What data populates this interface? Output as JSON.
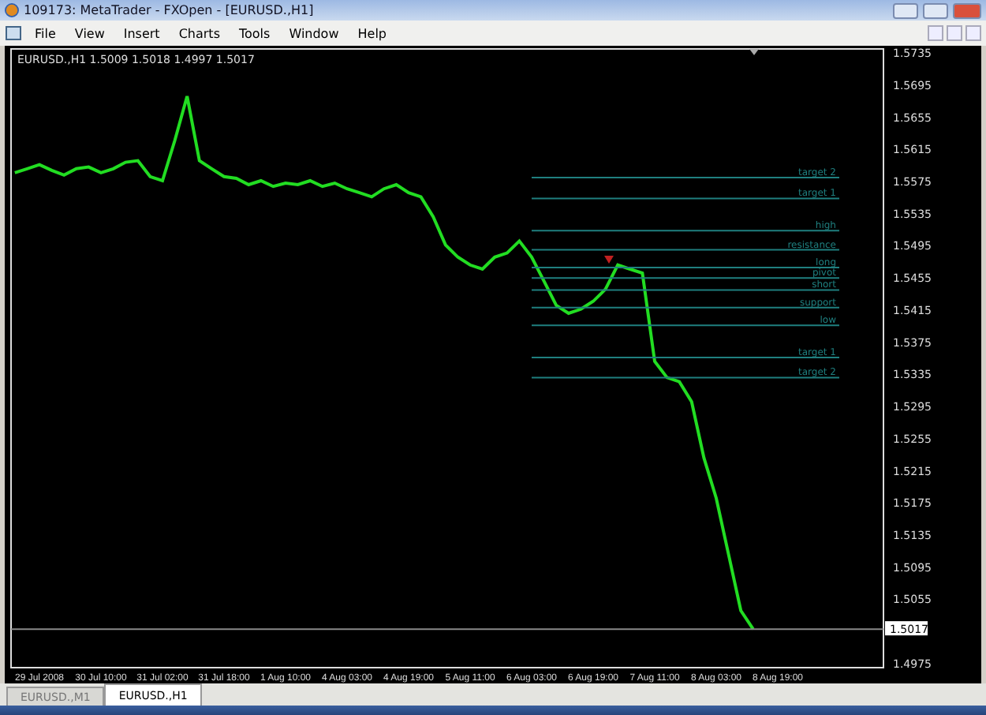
{
  "window": {
    "title": "109173: MetaTrader - FXOpen - [EURUSD.,H1]"
  },
  "menu": [
    "File",
    "View",
    "Insert",
    "Charts",
    "Tools",
    "Window",
    "Help"
  ],
  "chart": {
    "header_values": "1.5009 1.5018 1.4997 1.5017",
    "chart_data": {
      "type": "line",
      "categories": [
        null,
        null,
        "29 Jul 2008",
        null,
        null,
        null,
        null,
        "30 Jul 10:00",
        null,
        null,
        null,
        null,
        "31 Jul 02:00",
        null,
        null,
        null,
        null,
        "31 Jul 18:00",
        null,
        null,
        null,
        null,
        "1 Aug 10:00",
        null,
        null,
        null,
        null,
        "4 Aug 03:00",
        null,
        null,
        null,
        null,
        "4 Aug 19:00",
        null,
        null,
        null,
        null,
        "5 Aug 11:00",
        null,
        null,
        null,
        null,
        "6 Aug 03:00",
        null,
        null,
        null,
        null,
        "6 Aug 19:00",
        null,
        null,
        null,
        null,
        "7 Aug 11:00",
        null,
        null,
        null,
        null,
        "8 Aug 03:00",
        null,
        null,
        null,
        null,
        "8 Aug 19:00",
        null,
        null,
        null,
        null,
        null
      ],
      "series": [
        {
          "name": "EURUSD.,H1",
          "color": "#22dd22",
          "values": [
            1.5585,
            1.559,
            1.5595,
            1.5588,
            1.5582,
            1.559,
            1.5592,
            1.5585,
            1.559,
            1.5598,
            1.56,
            1.558,
            1.5575,
            1.5625,
            1.568,
            1.56,
            1.559,
            1.558,
            1.5578,
            1.557,
            1.5575,
            1.5568,
            1.5572,
            1.557,
            1.5575,
            1.5568,
            1.5572,
            1.5565,
            1.556,
            1.5555,
            1.5565,
            1.557,
            1.556,
            1.5555,
            1.553,
            1.5495,
            1.548,
            1.547,
            1.5465,
            1.548,
            1.5485,
            1.55,
            1.548,
            1.545,
            1.542,
            1.541,
            1.5415,
            1.5425,
            1.544,
            1.547,
            1.5465,
            1.546,
            1.535,
            1.533,
            1.5325,
            1.53,
            1.523,
            1.518,
            1.511,
            1.504,
            1.5017,
            null,
            null,
            null,
            null,
            null,
            null,
            null
          ]
        },
        {
          "name": "target 2",
          "color": "#1f7f7f",
          "values": [
            null,
            null,
            null,
            null,
            null,
            null,
            null,
            null,
            null,
            null,
            null,
            null,
            null,
            null,
            null,
            null,
            null,
            null,
            null,
            null,
            null,
            null,
            null,
            null,
            null,
            null,
            null,
            null,
            null,
            null,
            null,
            null,
            null,
            null,
            null,
            null,
            null,
            null,
            null,
            null,
            null,
            null,
            1.5579,
            1.5579,
            1.5579,
            1.5579,
            1.5579,
            1.5579,
            1.5579,
            1.5579,
            1.5579,
            1.5579,
            1.5579,
            1.5579,
            1.5579,
            1.5579,
            1.5579,
            1.5579,
            1.5579,
            1.5579,
            1.5579,
            1.5579,
            1.5579,
            1.5579,
            1.5579,
            1.5579,
            1.5579,
            1.5579
          ]
        },
        {
          "name": "target 1",
          "color": "#1f7f7f",
          "values": [
            null,
            null,
            null,
            null,
            null,
            null,
            null,
            null,
            null,
            null,
            null,
            null,
            null,
            null,
            null,
            null,
            null,
            null,
            null,
            null,
            null,
            null,
            null,
            null,
            null,
            null,
            null,
            null,
            null,
            null,
            null,
            null,
            null,
            null,
            null,
            null,
            null,
            null,
            null,
            null,
            null,
            null,
            1.5553,
            1.5553,
            1.5553,
            1.5553,
            1.5553,
            1.5553,
            1.5553,
            1.5553,
            1.5553,
            1.5553,
            1.5553,
            1.5553,
            1.5553,
            1.5553,
            1.5553,
            1.5553,
            1.5553,
            1.5553,
            1.5553,
            1.5553,
            1.5553,
            1.5553,
            1.5553,
            1.5553,
            1.5553,
            1.5553
          ]
        },
        {
          "name": "high",
          "color": "#1f7f7f",
          "values": [
            null,
            null,
            null,
            null,
            null,
            null,
            null,
            null,
            null,
            null,
            null,
            null,
            null,
            null,
            null,
            null,
            null,
            null,
            null,
            null,
            null,
            null,
            null,
            null,
            null,
            null,
            null,
            null,
            null,
            null,
            null,
            null,
            null,
            null,
            null,
            null,
            null,
            null,
            null,
            null,
            null,
            null,
            1.5513,
            1.5513,
            1.5513,
            1.5513,
            1.5513,
            1.5513,
            1.5513,
            1.5513,
            1.5513,
            1.5513,
            1.5513,
            1.5513,
            1.5513,
            1.5513,
            1.5513,
            1.5513,
            1.5513,
            1.5513,
            1.5513,
            1.5513,
            1.5513,
            1.5513,
            1.5513,
            1.5513,
            1.5513,
            1.5513
          ]
        },
        {
          "name": "resistance",
          "color": "#1f7f7f",
          "values": [
            null,
            null,
            null,
            null,
            null,
            null,
            null,
            null,
            null,
            null,
            null,
            null,
            null,
            null,
            null,
            null,
            null,
            null,
            null,
            null,
            null,
            null,
            null,
            null,
            null,
            null,
            null,
            null,
            null,
            null,
            null,
            null,
            null,
            null,
            null,
            null,
            null,
            null,
            null,
            null,
            null,
            null,
            1.5489,
            1.5489,
            1.5489,
            1.5489,
            1.5489,
            1.5489,
            1.5489,
            1.5489,
            1.5489,
            1.5489,
            1.5489,
            1.5489,
            1.5489,
            1.5489,
            1.5489,
            1.5489,
            1.5489,
            1.5489,
            1.5489,
            1.5489,
            1.5489,
            1.5489,
            1.5489,
            1.5489,
            1.5489,
            1.5489
          ]
        },
        {
          "name": "long",
          "color": "#1f7f7f",
          "values": [
            null,
            null,
            null,
            null,
            null,
            null,
            null,
            null,
            null,
            null,
            null,
            null,
            null,
            null,
            null,
            null,
            null,
            null,
            null,
            null,
            null,
            null,
            null,
            null,
            null,
            null,
            null,
            null,
            null,
            null,
            null,
            null,
            null,
            null,
            null,
            null,
            null,
            null,
            null,
            null,
            null,
            null,
            1.5467,
            1.5467,
            1.5467,
            1.5467,
            1.5467,
            1.5467,
            1.5467,
            1.5467,
            1.5467,
            1.5467,
            1.5467,
            1.5467,
            1.5467,
            1.5467,
            1.5467,
            1.5467,
            1.5467,
            1.5467,
            1.5467,
            1.5467,
            1.5467,
            1.5467,
            1.5467,
            1.5467,
            1.5467,
            1.5467
          ]
        },
        {
          "name": "pivot",
          "color": "#1f7f7f",
          "values": [
            null,
            null,
            null,
            null,
            null,
            null,
            null,
            null,
            null,
            null,
            null,
            null,
            null,
            null,
            null,
            null,
            null,
            null,
            null,
            null,
            null,
            null,
            null,
            null,
            null,
            null,
            null,
            null,
            null,
            null,
            null,
            null,
            null,
            null,
            null,
            null,
            null,
            null,
            null,
            null,
            null,
            null,
            1.5454,
            1.5454,
            1.5454,
            1.5454,
            1.5454,
            1.5454,
            1.5454,
            1.5454,
            1.5454,
            1.5454,
            1.5454,
            1.5454,
            1.5454,
            1.5454,
            1.5454,
            1.5454,
            1.5454,
            1.5454,
            1.5454,
            1.5454,
            1.5454,
            1.5454,
            1.5454,
            1.5454,
            1.5454,
            1.5454
          ]
        },
        {
          "name": "short",
          "color": "#1f7f7f",
          "values": [
            null,
            null,
            null,
            null,
            null,
            null,
            null,
            null,
            null,
            null,
            null,
            null,
            null,
            null,
            null,
            null,
            null,
            null,
            null,
            null,
            null,
            null,
            null,
            null,
            null,
            null,
            null,
            null,
            null,
            null,
            null,
            null,
            null,
            null,
            null,
            null,
            null,
            null,
            null,
            null,
            null,
            null,
            1.5439,
            1.5439,
            1.5439,
            1.5439,
            1.5439,
            1.5439,
            1.5439,
            1.5439,
            1.5439,
            1.5439,
            1.5439,
            1.5439,
            1.5439,
            1.5439,
            1.5439,
            1.5439,
            1.5439,
            1.5439,
            1.5439,
            1.5439,
            1.5439,
            1.5439,
            1.5439,
            1.5439,
            1.5439,
            1.5439
          ]
        },
        {
          "name": "support",
          "color": "#1f7f7f",
          "values": [
            null,
            null,
            null,
            null,
            null,
            null,
            null,
            null,
            null,
            null,
            null,
            null,
            null,
            null,
            null,
            null,
            null,
            null,
            null,
            null,
            null,
            null,
            null,
            null,
            null,
            null,
            null,
            null,
            null,
            null,
            null,
            null,
            null,
            null,
            null,
            null,
            null,
            null,
            null,
            null,
            null,
            null,
            1.5417,
            1.5417,
            1.5417,
            1.5417,
            1.5417,
            1.5417,
            1.5417,
            1.5417,
            1.5417,
            1.5417,
            1.5417,
            1.5417,
            1.5417,
            1.5417,
            1.5417,
            1.5417,
            1.5417,
            1.5417,
            1.5417,
            1.5417,
            1.5417,
            1.5417,
            1.5417,
            1.5417,
            1.5417,
            1.5417
          ]
        },
        {
          "name": "low",
          "color": "#1f7f7f",
          "values": [
            null,
            null,
            null,
            null,
            null,
            null,
            null,
            null,
            null,
            null,
            null,
            null,
            null,
            null,
            null,
            null,
            null,
            null,
            null,
            null,
            null,
            null,
            null,
            null,
            null,
            null,
            null,
            null,
            null,
            null,
            null,
            null,
            null,
            null,
            null,
            null,
            null,
            null,
            null,
            null,
            null,
            null,
            1.5395,
            1.5395,
            1.5395,
            1.5395,
            1.5395,
            1.5395,
            1.5395,
            1.5395,
            1.5395,
            1.5395,
            1.5395,
            1.5395,
            1.5395,
            1.5395,
            1.5395,
            1.5395,
            1.5395,
            1.5395,
            1.5395,
            1.5395,
            1.5395,
            1.5395,
            1.5395,
            1.5395,
            1.5395,
            1.5395
          ]
        },
        {
          "name": "target 1",
          "color": "#1f7f7f",
          "values": [
            null,
            null,
            null,
            null,
            null,
            null,
            null,
            null,
            null,
            null,
            null,
            null,
            null,
            null,
            null,
            null,
            null,
            null,
            null,
            null,
            null,
            null,
            null,
            null,
            null,
            null,
            null,
            null,
            null,
            null,
            null,
            null,
            null,
            null,
            null,
            null,
            null,
            null,
            null,
            null,
            null,
            null,
            1.5355,
            1.5355,
            1.5355,
            1.5355,
            1.5355,
            1.5355,
            1.5355,
            1.5355,
            1.5355,
            1.5355,
            1.5355,
            1.5355,
            1.5355,
            1.5355,
            1.5355,
            1.5355,
            1.5355,
            1.5355,
            1.5355,
            1.5355,
            1.5355,
            1.5355,
            1.5355,
            1.5355,
            1.5355,
            1.5355
          ]
        },
        {
          "name": "target 2",
          "color": "#1f7f7f",
          "values": [
            null,
            null,
            null,
            null,
            null,
            null,
            null,
            null,
            null,
            null,
            null,
            null,
            null,
            null,
            null,
            null,
            null,
            null,
            null,
            null,
            null,
            null,
            null,
            null,
            null,
            null,
            null,
            null,
            null,
            null,
            null,
            null,
            null,
            null,
            null,
            null,
            null,
            null,
            null,
            null,
            null,
            null,
            1.533,
            1.533,
            1.533,
            1.533,
            1.533,
            1.533,
            1.533,
            1.533,
            1.533,
            1.533,
            1.533,
            1.533,
            1.533,
            1.533,
            1.533,
            1.533,
            1.533,
            1.533,
            1.533,
            1.533,
            1.533,
            1.533,
            1.533,
            1.533,
            1.533,
            1.533
          ]
        },
        {
          "name": "1.5017",
          "color": "#888888",
          "values": [
            1.5017,
            1.5017,
            1.5017,
            1.5017,
            1.5017,
            1.5017,
            1.5017,
            1.5017,
            1.5017,
            1.5017,
            1.5017,
            1.5017,
            1.5017,
            1.5017,
            1.5017,
            1.5017,
            1.5017,
            1.5017,
            1.5017,
            1.5017,
            1.5017,
            1.5017,
            1.5017,
            1.5017,
            1.5017,
            1.5017,
            1.5017,
            1.5017,
            1.5017,
            1.5017,
            1.5017,
            1.5017,
            1.5017,
            1.5017,
            1.5017,
            1.5017,
            1.5017,
            1.5017,
            1.5017,
            1.5017,
            1.5017,
            1.5017,
            1.5017,
            1.5017,
            1.5017,
            1.5017,
            1.5017,
            1.5017,
            1.5017,
            1.5017,
            1.5017,
            1.5017,
            1.5017,
            1.5017,
            1.5017,
            1.5017,
            1.5017,
            1.5017,
            1.5017,
            1.5017,
            1.5017,
            1.5017,
            1.5017,
            1.5017,
            1.5017,
            1.5017,
            1.5017,
            1.5017
          ]
        }
      ],
      "ylim": [
        1.4969,
        1.5739
      ],
      "yticks": [
        {
          "value": 1.5735,
          "label": "1.5735"
        },
        {
          "value": 1.5695,
          "label": "1.5695"
        },
        {
          "value": 1.5655,
          "label": "1.5655"
        },
        {
          "value": 1.5615,
          "label": "1.5615"
        },
        {
          "value": 1.5575,
          "label": "1.5575"
        },
        {
          "value": 1.5535,
          "label": "1.5535"
        },
        {
          "value": 1.5495,
          "label": "1.5495"
        },
        {
          "value": 1.5455,
          "label": "1.5455"
        },
        {
          "value": 1.5415,
          "label": "1.5415"
        },
        {
          "value": 1.5375,
          "label": "1.5375"
        },
        {
          "value": 1.5335,
          "label": "1.5335"
        },
        {
          "value": 1.5295,
          "label": "1.5295"
        },
        {
          "value": 1.5255,
          "label": "1.5255"
        },
        {
          "value": 1.5215,
          "label": "1.5215"
        },
        {
          "value": 1.5175,
          "label": "1.5175"
        },
        {
          "value": 1.5135,
          "label": "1.5135"
        },
        {
          "value": 1.5095,
          "label": "1.5095"
        },
        {
          "value": 1.5055,
          "label": "1.5055"
        },
        {
          "value": 1.4975,
          "label": "1.4975"
        }
      ]
    }
  },
  "tabs": [
    {
      "label": "EURUSD.,M1",
      "selected": false
    },
    {
      "label": "EURUSD.,H1",
      "selected": true
    }
  ]
}
